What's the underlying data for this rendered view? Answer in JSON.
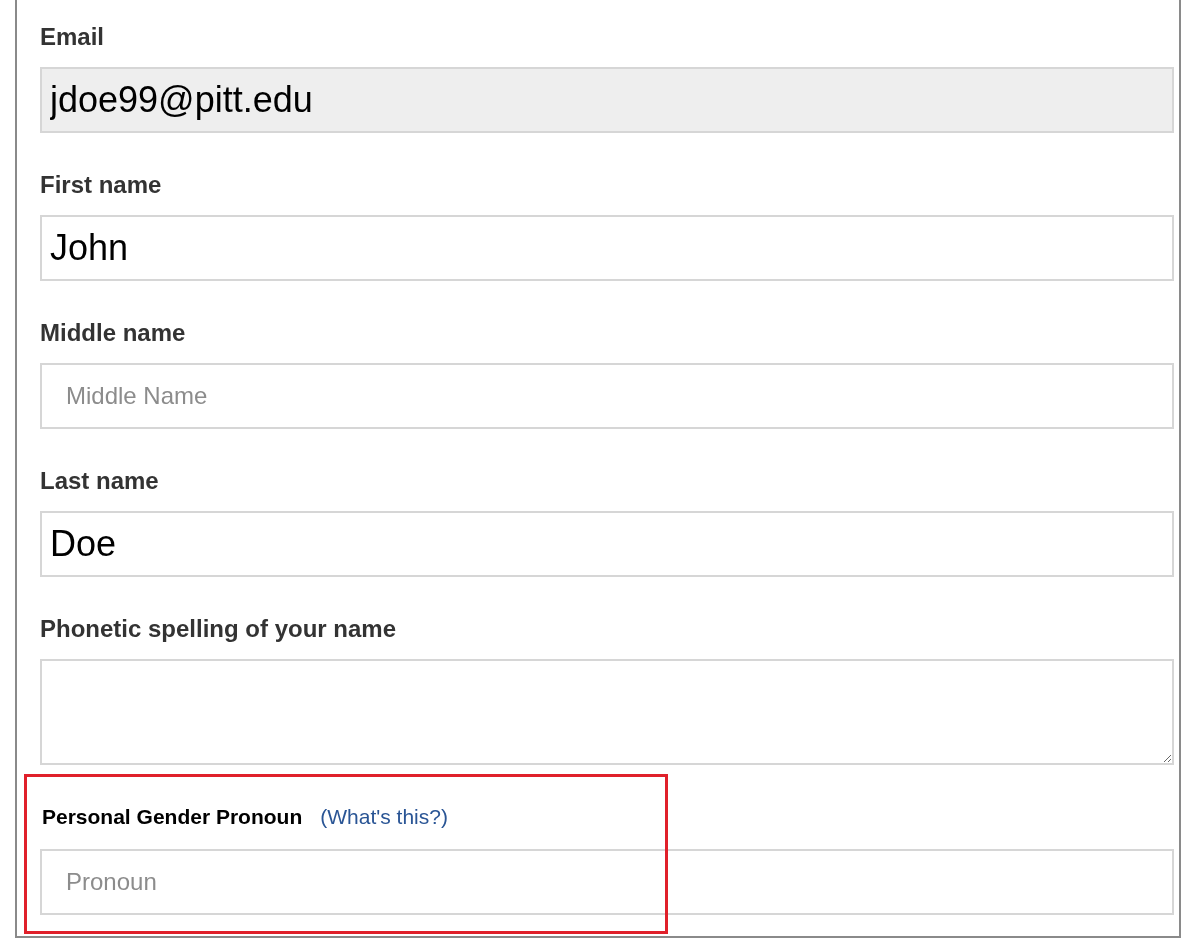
{
  "fields": [
    {
      "kind": "input",
      "label": "Email",
      "value": "jdoe99@pitt.edu",
      "disabled": true
    },
    {
      "kind": "input",
      "label": "First name",
      "value": "John",
      "disabled": false
    },
    {
      "kind": "input",
      "label": "Middle name",
      "placeholder": "Middle Name",
      "disabled": false
    },
    {
      "kind": "input",
      "label": "Last name",
      "value": "Doe",
      "disabled": false
    },
    {
      "kind": "textarea",
      "label": "Phonetic spelling of your name",
      "disabled": false
    },
    {
      "kind": "input",
      "label": "Personal Gender Pronoun",
      "link": "(What's this?)",
      "placeholder": "Pronoun",
      "disabled": false,
      "highlighted": true
    }
  ]
}
